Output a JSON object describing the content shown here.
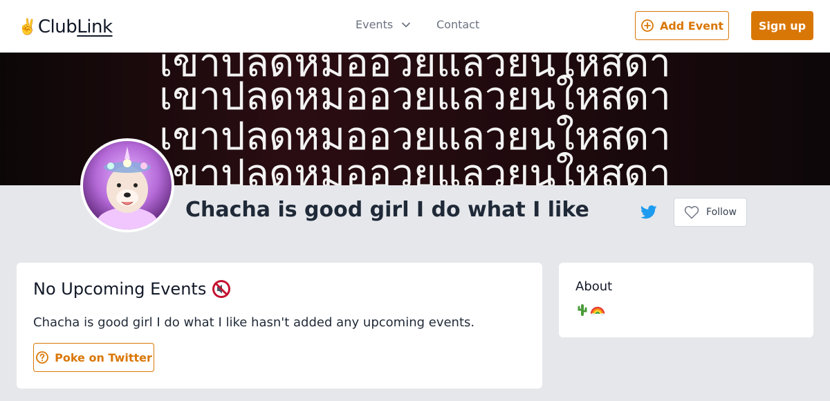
{
  "header": {
    "logo_text_a": "Club",
    "logo_text_b": "Link",
    "nav_events": "Events",
    "nav_contact": "Contact",
    "add_event": "Add Event",
    "sign_up": "Sign up"
  },
  "banner": {
    "lines": [
      "เขาปลดหมออวยแลวยนใหสดา",
      "เขาปลดหมออวยแลวยนใหสดา",
      "เขาปลดหมออวยแลวยนใหสดา",
      "เขาปลดหมออวยแลวยนใหสดา"
    ]
  },
  "profile": {
    "name": "Chacha is good girl I do what I like",
    "follow_label": "Follow"
  },
  "events_card": {
    "title": "No Upcoming Events",
    "message": "Chacha is good girl I do what I like hasn't added any upcoming events.",
    "poke_label": "Poke on Twitter"
  },
  "about_card": {
    "title": "About",
    "emoji": [
      "cactus",
      "rainbow"
    ]
  },
  "colors": {
    "accent": "#d97706",
    "twitter": "#1d9bf0",
    "page_bg": "#e5e7eb"
  }
}
